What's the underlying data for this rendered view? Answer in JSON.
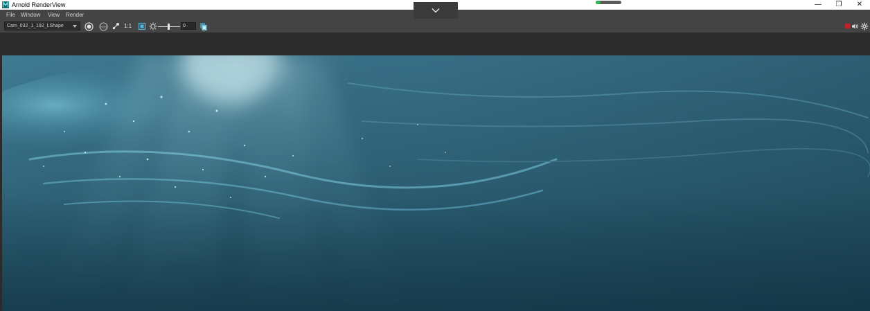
{
  "window": {
    "title": "Arnold RenderView",
    "app_icon": "maya-logo",
    "progress_fraction": 0.18,
    "controls": {
      "minimize_glyph": "—",
      "restore_glyph": "❐",
      "close_glyph": "✕"
    }
  },
  "menu": {
    "items": [
      {
        "label": "File"
      },
      {
        "label": "Window"
      },
      {
        "label": "View"
      },
      {
        "label": "Render"
      }
    ]
  },
  "collapse_tab": {
    "icon": "chevron-down-icon"
  },
  "toolbar": {
    "camera": "Cam_032_1_192_LShape",
    "zoom_label": "1:1",
    "exposure_value": "0",
    "icons": [
      "render-button-icon",
      "ipr-icon",
      "color-channel-icon",
      "region-crop-icon",
      "exposure-sun-icon",
      "snapshot-icon",
      "stop-render-icon",
      "debug-shading-icon",
      "settings-gear-icon"
    ]
  },
  "render": {
    "subject": "underwater-light-rays",
    "colors": {
      "deep": "#1e4659",
      "mid": "#36738d",
      "highlight": "#bff6ff",
      "surface": "#3f7a93"
    }
  },
  "accent_colors": {
    "progress": "#2fb34c",
    "stop": "#c0212b",
    "menubar": "#444444",
    "background": "#2b2b2b"
  }
}
